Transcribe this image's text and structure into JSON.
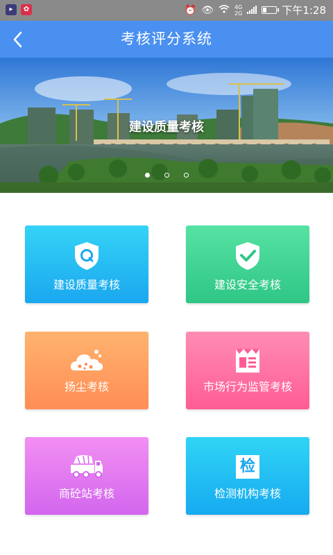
{
  "status_bar": {
    "time": "下午1:28",
    "app_icons": [
      "app-a-icon",
      "huawei-icon"
    ],
    "icons": [
      "alarm-icon",
      "eye-icon",
      "wifi-icon",
      "signal-icon",
      "battery-icon"
    ],
    "network": "4G",
    "network2": "2G",
    "battery_level": 0.3
  },
  "nav": {
    "title": "考核评分系统",
    "back_icon": "chevron-left-icon"
  },
  "banner": {
    "caption": "建设质量考核",
    "slide_count": 3,
    "active_slide": 0
  },
  "tiles": [
    {
      "label": "建设质量考核",
      "icon": "shield-q-icon",
      "color": "#1aa7ef"
    },
    {
      "label": "建设安全考核",
      "icon": "shield-check-icon",
      "color": "#2fc686"
    },
    {
      "label": "扬尘考核",
      "icon": "dust-cloud-icon",
      "color": "#ff8d55"
    },
    {
      "label": "市场行为监管考核",
      "icon": "market-store-icon",
      "color": "#ff5c95"
    },
    {
      "label": "商砼站考核",
      "icon": "concrete-truck-icon",
      "color": "#d266ee"
    },
    {
      "label": "检测机构考核",
      "icon": "inspection-badge-icon",
      "color": "#16aaf0",
      "badge_char": "检"
    }
  ]
}
